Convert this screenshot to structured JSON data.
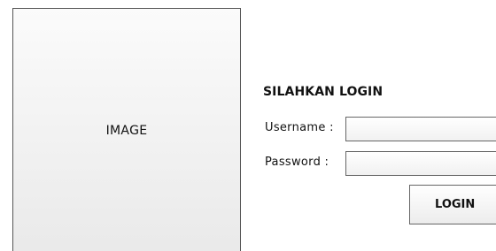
{
  "image_panel": {
    "label": "IMAGE"
  },
  "login": {
    "title": "SILAHKAN LOGIN",
    "username_label": "Username :",
    "username_value": "",
    "password_label": "Password :",
    "password_value": "",
    "button_label": "LOGIN"
  }
}
